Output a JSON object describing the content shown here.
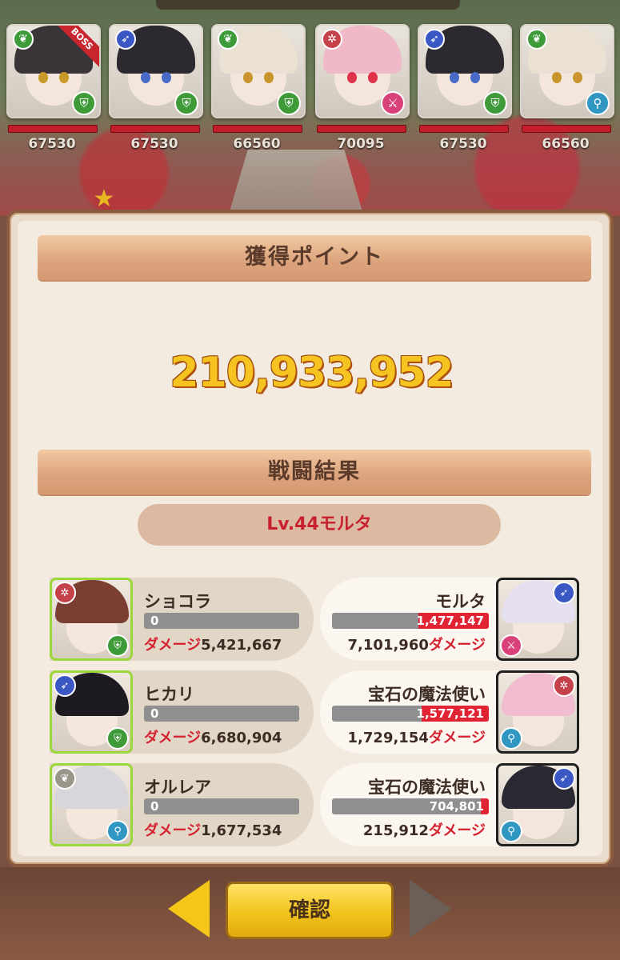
{
  "enemies": [
    {
      "hp": "67530",
      "boss": "BOSS",
      "element": "leaf-icon",
      "role": "shield-icon",
      "hair": "#3a3338",
      "eye": "#c89a2a"
    },
    {
      "hp": "67530",
      "element": "feather-icon",
      "role": "shield-icon",
      "hair": "#2c2a30",
      "eye": "#4a6ac8"
    },
    {
      "hp": "66560",
      "element": "leaf-icon",
      "role": "shield-icon",
      "hair": "#eae1d2",
      "eye": "#c8962c"
    },
    {
      "hp": "70095",
      "element": "gear-icon",
      "role": "sword-icon",
      "hair": "#f0b9c8",
      "eye": "#e0304a"
    },
    {
      "hp": "67530",
      "element": "feather-icon",
      "role": "shield-icon",
      "hair": "#2c2a30",
      "eye": "#4a6ac8"
    },
    {
      "hp": "66560",
      "element": "leaf-icon",
      "role": "staff-icon",
      "hair": "#eae1d2",
      "eye": "#c8962c"
    }
  ],
  "points_section": {
    "title": "獲得ポイント",
    "value": "210,933,952"
  },
  "battle_section": {
    "title": "戦闘結果",
    "enemy_level": "Lv.44モルタ"
  },
  "results": [
    {
      "ally": {
        "name": "ショコラ",
        "hp": "0",
        "damage_label": "ダメージ",
        "damage": "5,421,667",
        "hair": "#7a3e32"
      },
      "foe": {
        "name": "モルタ",
        "hp": "1,477,147",
        "hp_fraction": 0.45,
        "damage": "7,101,960",
        "damage_label": "ダメージ",
        "hair": "#e6dff0"
      }
    },
    {
      "ally": {
        "name": "ヒカリ",
        "hp": "0",
        "damage_label": "ダメージ",
        "damage": "6,680,904",
        "hair": "#1e1a22"
      },
      "foe": {
        "name": "宝石の魔法使い",
        "hp": "1,577,121",
        "hp_fraction": 0.43,
        "damage": "1,729,154",
        "damage_label": "ダメージ",
        "hair": "#f2bcd0"
      }
    },
    {
      "ally": {
        "name": "オルレア",
        "hp": "0",
        "damage_label": "ダメージ",
        "damage": "1,677,534",
        "hair": "#d8d6da"
      },
      "foe": {
        "name": "宝石の魔法使い",
        "hp": "704,801",
        "hp_fraction": 0.05,
        "damage": "215,912",
        "damage_label": "ダメージ",
        "hair": "#2a2830"
      }
    }
  ],
  "footer": {
    "confirm_label": "確認"
  }
}
